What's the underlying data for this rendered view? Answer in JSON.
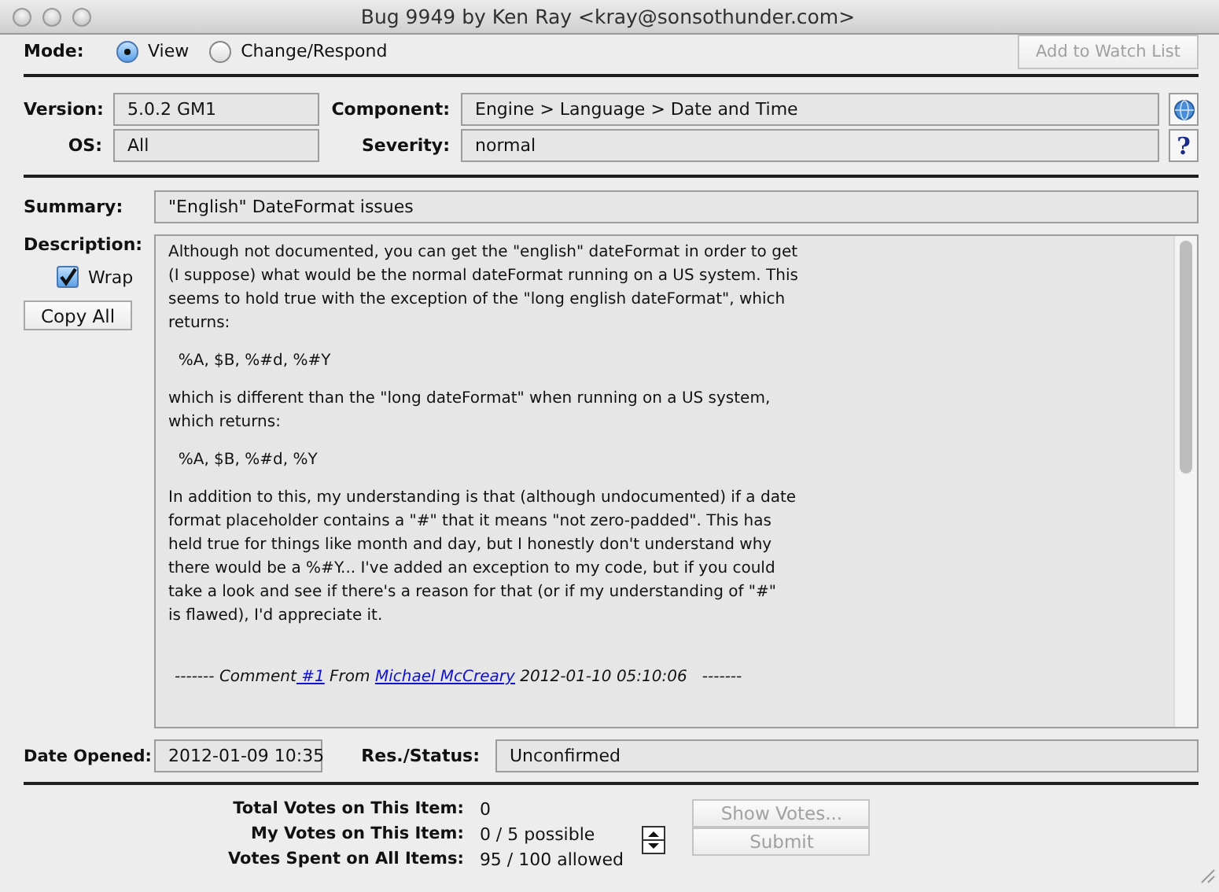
{
  "window": {
    "title": "Bug 9949 by Ken Ray <kray@sonsothunder.com>"
  },
  "mode": {
    "label": "Mode:",
    "options": [
      {
        "label": "View",
        "selected": true
      },
      {
        "label": "Change/Respond",
        "selected": false
      }
    ]
  },
  "watch_button": {
    "label": "Add to Watch List",
    "disabled": true
  },
  "details": {
    "version": {
      "label": "Version:",
      "value": "5.0.2 GM1"
    },
    "component": {
      "label": "Component:",
      "value": "Engine > Language > Date and Time"
    },
    "os": {
      "label": "OS:",
      "value": "All"
    },
    "severity": {
      "label": "Severity:",
      "value": "normal",
      "help": "?"
    }
  },
  "summary": {
    "label": "Summary:",
    "value": "\"English\" DateFormat issues"
  },
  "description": {
    "label": "Description:",
    "wrap": {
      "label": "Wrap",
      "checked": true
    },
    "copy_button": "Copy All",
    "paragraphs": [
      [
        "Although not documented, you can get the \"english\" dateFormat in order to get",
        "(I suppose) what would be the normal dateFormat running on a US system. This",
        "seems to hold true with the exception of the \"long english dateFormat\", which",
        "returns:"
      ],
      [
        "  %A, $B, %#d, %#Y"
      ],
      [
        "which is different than the \"long dateFormat\" when running on a US system,",
        "which returns:"
      ],
      [
        "  %A, $B, %#d, %Y"
      ],
      [
        "In addition to this, my understanding is that (although undocumented) if a date",
        "format placeholder contains a \"#\" that it means \"not zero-padded\". This has",
        "held true for things like month and day, but I honestly don't understand why",
        "there would be a %#Y... I've added an exception to my code, but if you could",
        "take a look and see if there's a reason for that (or if my understanding of \"#\"",
        "is flawed), I'd appreciate it."
      ]
    ],
    "comment": {
      "prefix": "------- Comment",
      "number": " #1",
      "from": "From",
      "author": "Michael McCreary",
      "date": "2012-01-10 05:10:06",
      "suffix": "-------"
    }
  },
  "dates": {
    "opened": {
      "label": "Date Opened:",
      "value": "2012-01-09 10:35"
    },
    "status": {
      "label": "Res./Status:",
      "value": "Unconfirmed"
    }
  },
  "votes": {
    "rows": [
      {
        "label": "Total Votes on This Item:",
        "value": "0"
      },
      {
        "label": "My Votes on This Item:",
        "value": "0 / 5 possible"
      },
      {
        "label": "Votes Spent on All Items:",
        "value": "95 / 100 allowed"
      }
    ],
    "buttons": [
      {
        "label": "Show Votes...",
        "disabled": true
      },
      {
        "label": "Submit",
        "disabled": true
      }
    ]
  }
}
